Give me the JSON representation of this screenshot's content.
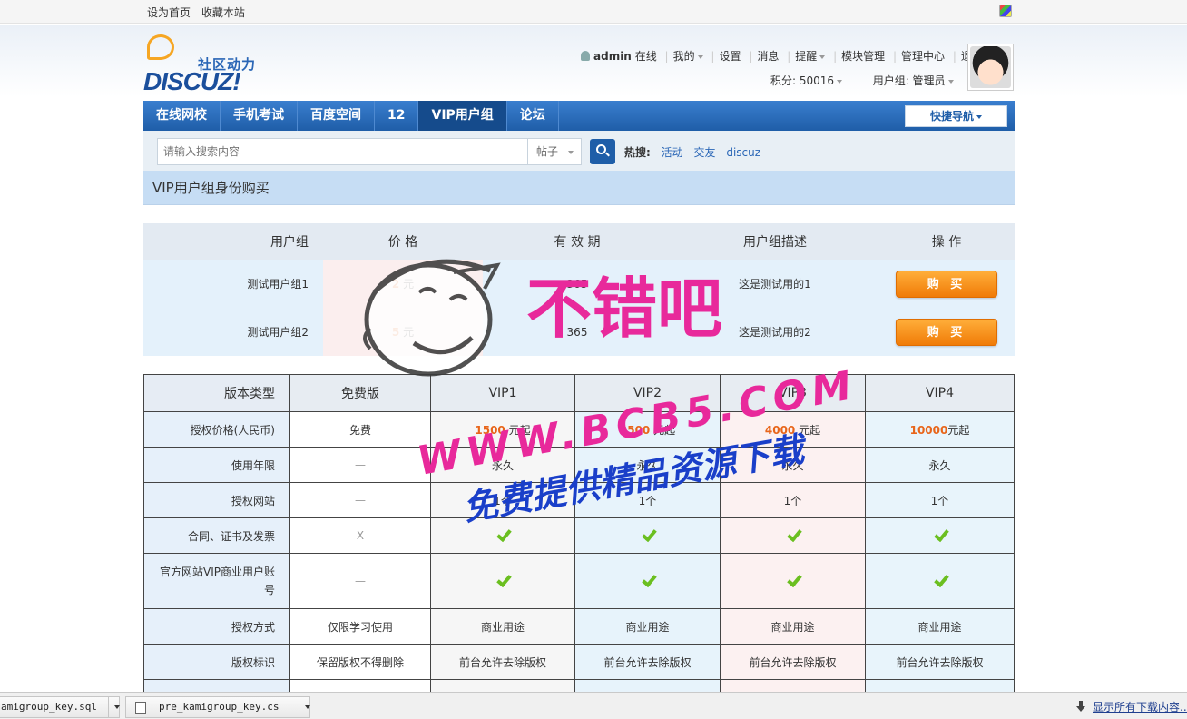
{
  "topbar": {
    "set_home": "设为首页",
    "bookmark": "收藏本站"
  },
  "logo": {
    "cn": "社区动力",
    "en": "DISCUZ!"
  },
  "user": {
    "name": "admin",
    "status": "在线",
    "menu": [
      "我的",
      "设置",
      "消息",
      "提醒",
      "模块管理",
      "管理中心",
      "退出"
    ],
    "points_label": "积分: 50016",
    "group_label": "用户组: 管理员"
  },
  "nav": {
    "items": [
      "在线网校",
      "手机考试",
      "百度空间",
      "12",
      "VIP用户组",
      "论坛"
    ],
    "quick": "快捷导航"
  },
  "search": {
    "placeholder": "请输入搜索内容",
    "type": "帖子",
    "hot_label": "热搜:",
    "hot": [
      "活动",
      "交友",
      "discuz"
    ]
  },
  "page_title": "VIP用户组身份购买",
  "group_table": {
    "headers": [
      "用户组",
      "价 格",
      "有 效 期",
      "用户组描述",
      "操 作"
    ],
    "rows": [
      {
        "name": "测试用户组1",
        "price": "2",
        "unit": "元",
        "days": "365",
        "desc": "这是测试用的1",
        "action": "购 买"
      },
      {
        "name": "测试用户组2",
        "price": "5",
        "unit": "元",
        "days": "365",
        "desc": "这是测试用的2",
        "action": "购 买"
      }
    ]
  },
  "compare": {
    "headers": [
      "版本类型",
      "免费版",
      "VIP1",
      "VIP2",
      "VIP3",
      "VIP4"
    ],
    "rows": [
      {
        "label": "授权价格(人民币)",
        "cells": [
          "免费",
          "1500 元起",
          "3500 元起",
          "4000 元起",
          "10000元起"
        ]
      },
      {
        "label": "使用年限",
        "cells": [
          "—",
          "永久",
          "永久",
          "永久",
          "永久"
        ]
      },
      {
        "label": "授权网站",
        "cells": [
          "—",
          "1个",
          "1个",
          "1个",
          "1个"
        ]
      },
      {
        "label": "合同、证书及发票",
        "cells": [
          "X",
          "check",
          "check",
          "check",
          "check"
        ]
      },
      {
        "label": "官方网站VIP商业用户账号",
        "cells": [
          "—",
          "check",
          "check",
          "check",
          "check"
        ]
      },
      {
        "label": "授权方式",
        "cells": [
          "仅限学习使用",
          "商业用途",
          "商业用途",
          "商业用途",
          "商业用途"
        ]
      },
      {
        "label": "版权标识",
        "cells": [
          "保留版权不得删除",
          "前台允许去除版权",
          "前台允许去除版权",
          "前台允许去除版权",
          "前台允许去除版权"
        ]
      }
    ],
    "price_amounts": [
      "1500",
      "3500",
      "4000",
      "10000"
    ],
    "price_suffixes": [
      " 元起",
      " 元起",
      " 元起",
      "元起"
    ]
  },
  "watermark": {
    "line1": "不错吧",
    "line2": "WWW.BCB5.COM",
    "line3": "免费提供精品资源下载"
  },
  "downloads": {
    "items": [
      "amigroup_key.sql",
      "pre_kamigroup_key.cs"
    ],
    "show_all": "显示所有下载内容..."
  },
  "colors": {
    "nav": "#1f5ea8",
    "accent_orange": "#f07b07",
    "watermark_pink": "#e8299b",
    "watermark_blue": "#1a3fc9"
  }
}
